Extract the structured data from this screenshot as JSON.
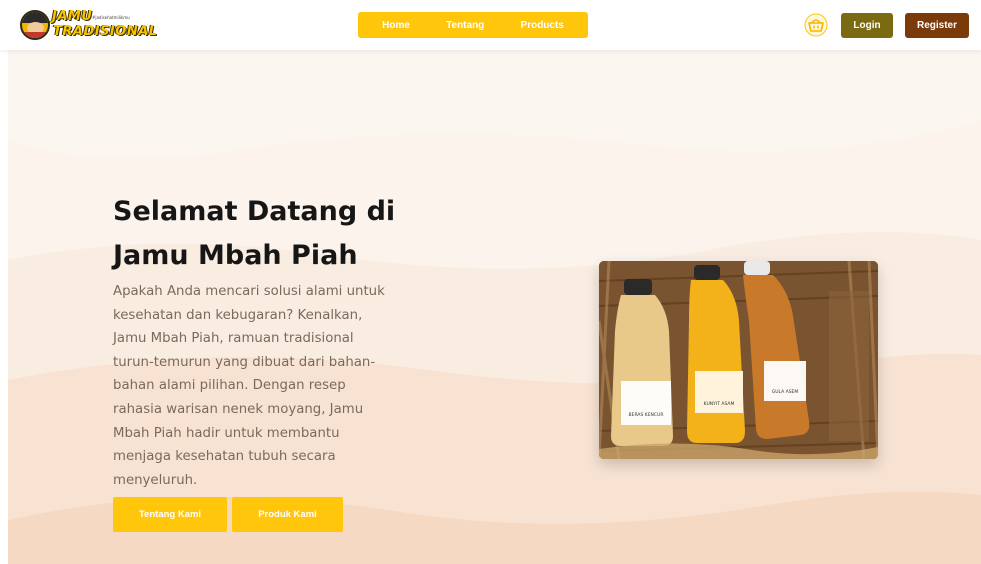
{
  "brand": {
    "logo_line1": "JAMU",
    "logo_line2": "TRADISIONAL",
    "logo_tagline": "#jadisehatmilikmu"
  },
  "nav": {
    "items": [
      {
        "label": "Home"
      },
      {
        "label": "Tentang"
      },
      {
        "label": "Products"
      }
    ]
  },
  "header_actions": {
    "cart_icon": "basket-icon",
    "login_label": "Login",
    "register_label": "Register"
  },
  "hero": {
    "title_line1": "Selamat Datang di",
    "title_line2": "Jamu Mbah Piah",
    "description": "Apakah Anda mencari solusi alami untuk kesehatan dan kebugaran? Kenalkan, Jamu Mbah Piah, ramuan tradisional turun-temurun yang dibuat dari bahan-bahan alami pilihan. Dengan resep rahasia warisan nenek moyang, Jamu Mbah Piah hadir untuk membantu menjaga kesehatan tubuh secara menyeluruh.",
    "button_about": "Tentang Kami",
    "button_products": "Produk Kami",
    "bottle_labels": [
      "BERAS KENCUR",
      "KUNYIT ASAM",
      "GULA ASEM"
    ]
  },
  "colors": {
    "accent": "#ffc60b",
    "login": "#7a6a12",
    "register": "#7a3a0a",
    "hero_bg": "#fbf3ec"
  }
}
